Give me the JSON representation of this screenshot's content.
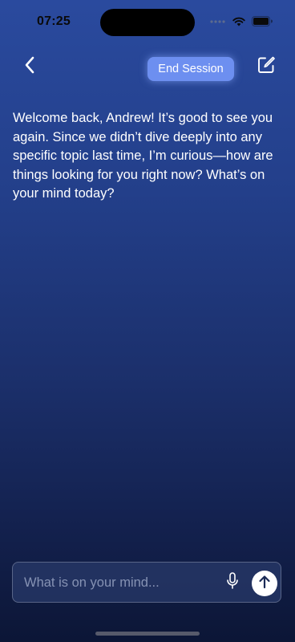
{
  "status_bar": {
    "time": "07:25"
  },
  "header": {
    "end_session_label": "End Session"
  },
  "chat": {
    "message": "Welcome back, Andrew! It’s good to see you again. Since we didn’t dive deeply into any specific topic last time, I’m curious—how are things looking for you right now? What’s on your mind today?"
  },
  "composer": {
    "placeholder": "What is on your mind...",
    "value": ""
  },
  "icons": {
    "back": "chevron-left-icon",
    "compose": "compose-icon",
    "mic": "microphone-icon",
    "send": "arrow-up-icon",
    "wifi": "wifi-icon",
    "battery": "battery-icon",
    "signal": "signal-icon"
  },
  "colors": {
    "background_top": "#2a4a9e",
    "background_bottom": "#0c1636",
    "accent": "#6d8ff0"
  }
}
